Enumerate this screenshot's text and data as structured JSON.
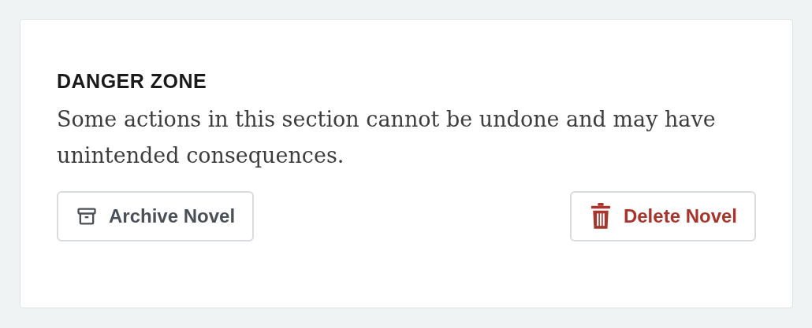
{
  "section": {
    "title": "DANGER ZONE",
    "description": "Some actions in this section cannot be undone and may have unintended consequences."
  },
  "buttons": [
    {
      "label": "Archive Novel",
      "kind": "archive"
    },
    {
      "label": "Delete Novel",
      "kind": "delete"
    }
  ]
}
